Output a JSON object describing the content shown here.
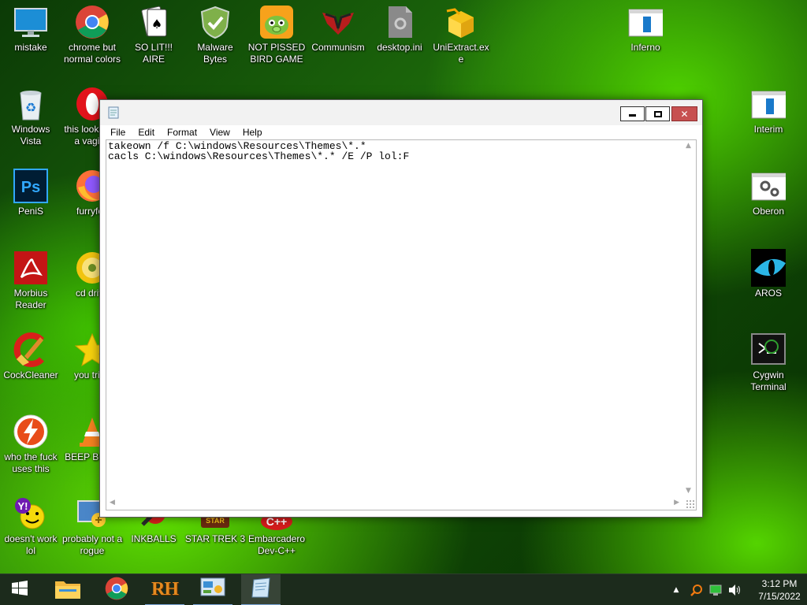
{
  "desktop": {
    "icons_left": [
      {
        "label": "mistake",
        "icon": "monitor-icon"
      },
      {
        "label": "chrome but normal colors",
        "icon": "chrome-icon"
      },
      {
        "label": "SO LIT!!! AIRE",
        "icon": "solitaire-icon"
      },
      {
        "label": "Malware Bytes",
        "icon": "shield-icon"
      },
      {
        "label": "NOT PISSED BIRD GAME",
        "icon": "angry-birds-icon"
      },
      {
        "label": "Communism",
        "icon": "emblem-icon"
      },
      {
        "label": "desktop.ini",
        "icon": "settings-file-icon"
      },
      {
        "label": "UniExtract.exe",
        "icon": "box-icon"
      },
      {
        "label": "Windows Vista",
        "icon": "recycle-bin-icon"
      },
      {
        "label": "this looks like a vagina",
        "icon": "opera-icon"
      },
      {
        "label": "PeniS",
        "icon": "photoshop-icon"
      },
      {
        "label": "furryfox",
        "icon": "firefox-icon"
      },
      {
        "label": "Morbius Reader",
        "icon": "acrobat-icon"
      },
      {
        "label": "cd drive",
        "icon": "disc-icon"
      },
      {
        "label": "CockCleaner",
        "icon": "ccleaner-icon"
      },
      {
        "label": "you tried",
        "icon": "star-icon"
      },
      {
        "label": "who the fuck uses this",
        "icon": "flash-icon"
      },
      {
        "label": "BEEP BOOP",
        "icon": "vlc-icon"
      },
      {
        "label": "doesn't work lol",
        "icon": "yahoo-icon"
      },
      {
        "label": "probably not a rogue",
        "icon": "install-icon"
      },
      {
        "label": "INKBALLS",
        "icon": "inkball-icon"
      },
      {
        "label": "STAR TREK 3",
        "icon": "star-wars-icon"
      },
      {
        "label": "Embarcadero Dev-C++",
        "icon": "cpp-icon"
      }
    ],
    "icons_right": [
      {
        "label": "Inferno",
        "icon": "app-window-icon"
      },
      {
        "label": "Interim",
        "icon": "app-window-icon"
      },
      {
        "label": "Oberon",
        "icon": "gears-icon"
      },
      {
        "label": "AROS",
        "icon": "cat-eye-icon"
      },
      {
        "label": "Cygwin Terminal",
        "icon": "terminal-icon"
      }
    ]
  },
  "notepad": {
    "title": "",
    "menu": [
      "File",
      "Edit",
      "Format",
      "View",
      "Help"
    ],
    "content": "takeown /f C:\\windows\\Resources\\Themes\\*.*\ncacls C:\\windows\\Resources\\Themes\\*.* /E /P lol:F",
    "buttons": {
      "minimize": "minimize",
      "maximize": "maximize",
      "close": "close"
    }
  },
  "taskbar": {
    "start_icon": "windows-logo-icon",
    "apps": [
      {
        "name": "file-explorer",
        "icon": "folder-icon"
      },
      {
        "name": "chrome",
        "icon": "chrome-icon"
      },
      {
        "name": "rh",
        "icon": "rh-icon",
        "label": "RH"
      },
      {
        "name": "control-panel",
        "icon": "control-panel-icon"
      },
      {
        "name": "notepad",
        "icon": "notepad-icon"
      }
    ],
    "tray": {
      "time": "3:12 PM",
      "date": "7/15/2022"
    }
  },
  "colors": {
    "accent": "#1979ca",
    "close_button": "#c75050",
    "taskbar": "#1c2b1c"
  }
}
